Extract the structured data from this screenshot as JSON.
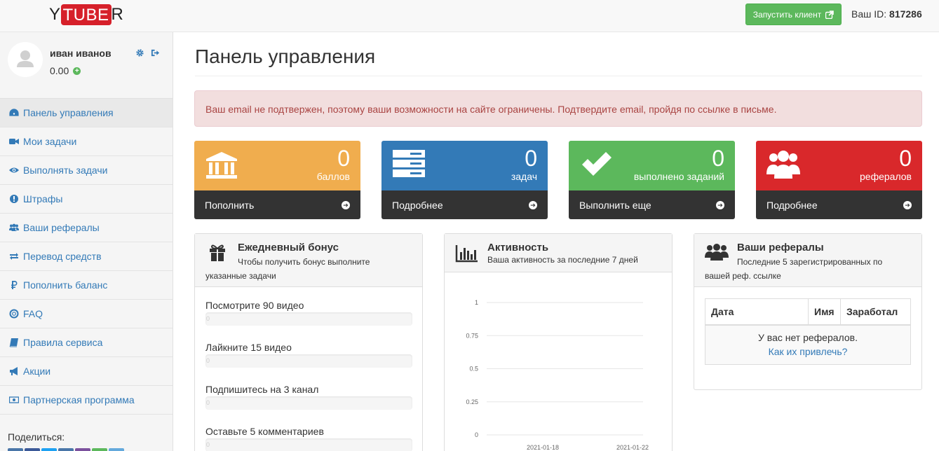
{
  "header": {
    "logo_left": "Y",
    "logo_mid": "TUBE",
    "logo_right": "R",
    "launch_label": "Запустить клиент",
    "user_id_label": "Ваш ID:",
    "user_id": "817286"
  },
  "profile": {
    "name": "иван иванов",
    "balance": "0.00"
  },
  "sidebar": {
    "items": [
      {
        "label": "Панель управления",
        "icon": "dashboard-icon",
        "active": true
      },
      {
        "label": "Мои задачи",
        "icon": "video-camera-icon"
      },
      {
        "label": "Выполнять задачи",
        "icon": "eye-icon"
      },
      {
        "label": "Штрафы",
        "icon": "exclamation-circle-icon"
      },
      {
        "label": "Ваши рефералы",
        "icon": "users-icon"
      },
      {
        "label": "Перевод средств",
        "icon": "exchange-icon"
      },
      {
        "label": "Пополнить баланс",
        "icon": "ruble-icon"
      },
      {
        "label": "FAQ",
        "icon": "life-ring-icon"
      },
      {
        "label": "Правила сервиса",
        "icon": "book-icon"
      },
      {
        "label": "Акции",
        "icon": "bullhorn-icon"
      },
      {
        "label": "Партнерская программа",
        "icon": "money-icon"
      }
    ],
    "share_label": "Поделиться:"
  },
  "main": {
    "title": "Панель управления",
    "alert": "Ваш email не подтвержен, поэтому ваши возможности на сайте ограничены. Подтвердите email, пройдя по ссылке в письме."
  },
  "stats": [
    {
      "value": "0",
      "label": "баллов",
      "action": "Пополнить",
      "color": "#f0ad4e",
      "icon": "bank-icon"
    },
    {
      "value": "0",
      "label": "задач",
      "action": "Подробнее",
      "color": "#337ab7",
      "icon": "tasks-list-icon"
    },
    {
      "value": "0",
      "label": "выполнено заданий",
      "action": "Выполнить еще",
      "color": "#5cb85c",
      "icon": "check-icon"
    },
    {
      "value": "0",
      "label": "рефералов",
      "action": "Подробнее",
      "color": "#d9282b",
      "icon": "users-icon"
    }
  ],
  "bonus": {
    "title": "Ежедневный бонус",
    "subtitle": "Чтобы получить бонус выполните указанные задачи",
    "tasks": [
      {
        "label": "Посмотрите 90 видео",
        "progress": "0"
      },
      {
        "label": "Лайкните 15 видео",
        "progress": "0"
      },
      {
        "label": "Подпишитесь на 3 канал",
        "progress": "0"
      },
      {
        "label": "Оставьте 5 комментариев",
        "progress": "0"
      }
    ]
  },
  "activity": {
    "title": "Активность",
    "subtitle": "Ваша активность за последние 7 дней"
  },
  "chart_data": {
    "type": "line",
    "title": "",
    "xlabel": "",
    "ylabel": "",
    "x_tick_labels": [
      "2021-01-18",
      "2021-01-22"
    ],
    "y_ticks": [
      "1",
      "0.75",
      "0.5",
      "0.25",
      "0"
    ],
    "ylim": [
      0,
      1
    ],
    "series": []
  },
  "referrals": {
    "title": "Ваши рефералы",
    "subtitle": "Последние 5 зарегистрированных по вашей реф. ссылке",
    "columns": [
      "Дата",
      "Имя",
      "Заработал"
    ],
    "empty_text": "У вас нет рефералов.",
    "empty_link": "Как их привлечь?"
  },
  "colors": {
    "link": "#337ab7",
    "success": "#5cb85c",
    "brand_red": "#d6202a"
  }
}
